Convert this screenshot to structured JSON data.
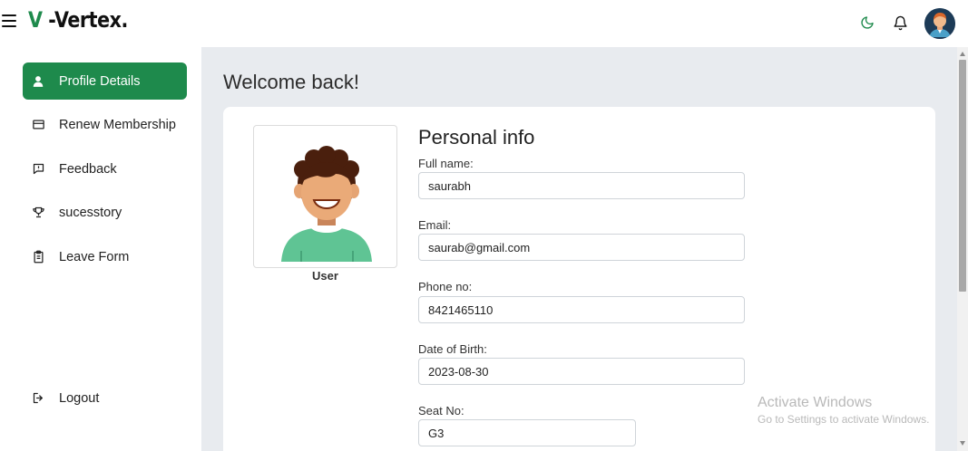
{
  "header": {
    "brand_v": "V",
    "brand_rest": " -Vertex.",
    "icons": [
      "menu-icon",
      "moon-icon",
      "bell-icon",
      "avatar"
    ]
  },
  "sidebar": {
    "items": [
      {
        "label": "Profile Details",
        "icon": "user-icon",
        "active": true
      },
      {
        "label": "Renew Membership",
        "icon": "card-icon",
        "active": false
      },
      {
        "label": "Feedback",
        "icon": "feedback-icon",
        "active": false
      },
      {
        "label": "sucesstory",
        "icon": "trophy-icon",
        "active": false
      },
      {
        "label": "Leave Form",
        "icon": "clipboard-icon",
        "active": false
      }
    ],
    "logout_label": "Logout"
  },
  "main": {
    "welcome": "Welcome back!",
    "user_label": "User",
    "personal_info_title": "Personal info",
    "fields": [
      {
        "label": "Full name:",
        "value": "saurabh"
      },
      {
        "label": "Email:",
        "value": "saurab@gmail.com"
      },
      {
        "label": "Phone no:",
        "value": "8421465110"
      },
      {
        "label": "Date of Birth:",
        "value": "2023-08-30"
      },
      {
        "label": "Seat No:",
        "value": "G3"
      }
    ]
  },
  "watermark": {
    "line1": "Activate Windows",
    "line2": "Go to Settings to activate Windows."
  },
  "colors": {
    "accent": "#1e8a4c",
    "main_bg": "#e8ebef"
  }
}
